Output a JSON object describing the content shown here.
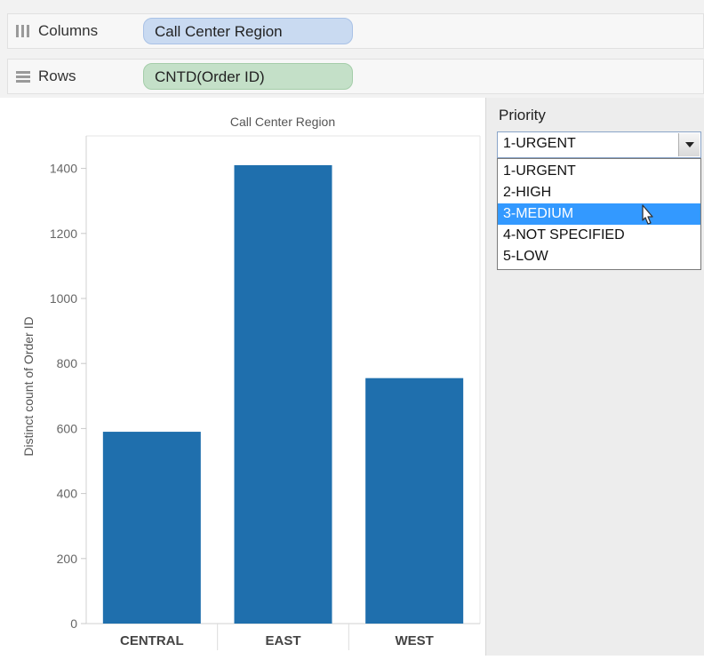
{
  "shelves": {
    "columns": {
      "label": "Columns",
      "pill": "Call Center Region"
    },
    "rows": {
      "label": "Rows",
      "pill": "CNTD(Order ID)"
    }
  },
  "filter": {
    "title": "Priority",
    "selected_value": "1-URGENT",
    "options": [
      "1-URGENT",
      "2-HIGH",
      "3-MEDIUM",
      "4-NOT SPECIFIED",
      "5-LOW"
    ],
    "highlighted_index": 2
  },
  "colors": {
    "bar": "#1f6fad",
    "pill_blue": "#c9daf1",
    "pill_green": "#c4e0c8",
    "highlight": "#3399ff"
  },
  "chart_data": {
    "type": "bar",
    "title": "Call Center Region",
    "ylabel": "Distinct count of Order ID",
    "xlabel": "",
    "categories": [
      "CENTRAL",
      "EAST",
      "WEST"
    ],
    "values": [
      590,
      1410,
      755
    ],
    "ylim": [
      0,
      1500
    ],
    "yticks": [
      0,
      200,
      400,
      600,
      800,
      1000,
      1200,
      1400
    ],
    "grid": false
  }
}
